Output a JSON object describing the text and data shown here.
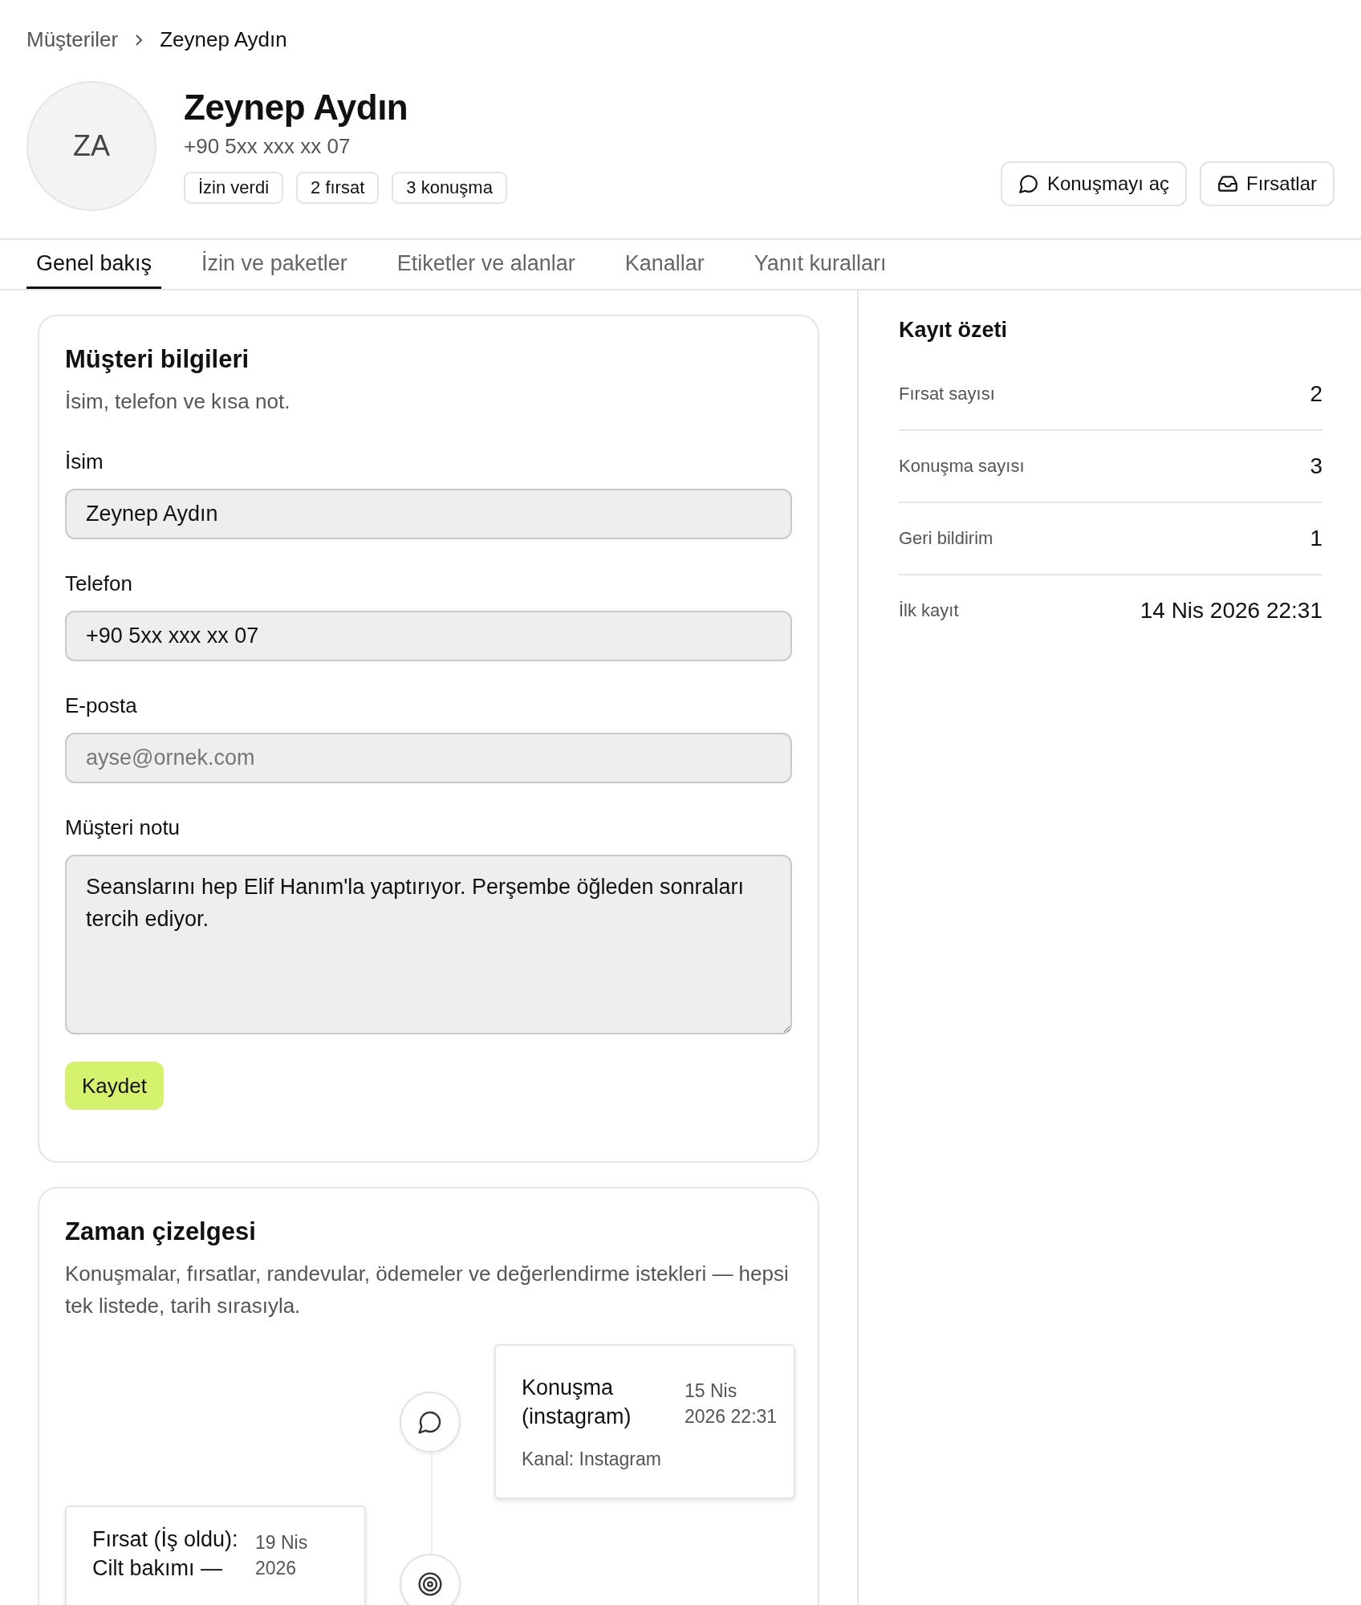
{
  "breadcrumb": {
    "parent": "Müşteriler",
    "current": "Zeynep Aydın"
  },
  "profile": {
    "initials": "ZA",
    "name": "Zeynep Aydın",
    "phone": "+90 5xx xxx xx 07",
    "chips": [
      "İzin verdi",
      "2 fırsat",
      "3 konuşma"
    ]
  },
  "actions": [
    {
      "kind": "chat",
      "label": "Konuşmayı aç"
    },
    {
      "kind": "inbox",
      "label": "Fırsatlar"
    }
  ],
  "tabs": [
    {
      "label": "Genel bakış",
      "selected": true
    },
    {
      "label": "İzin ve paketler",
      "selected": false
    },
    {
      "label": "Etiketler ve alanlar",
      "selected": false
    },
    {
      "label": "Kanallar",
      "selected": false
    },
    {
      "label": "Yanıt kuralları",
      "selected": false
    }
  ],
  "form": {
    "title": "Müşteri bilgileri",
    "subtitle": "İsim, telefon ve kısa not.",
    "fields": [
      {
        "kind": "input",
        "label": "İsim",
        "value": "Zeynep Aydın"
      },
      {
        "kind": "input",
        "label": "Telefon",
        "value": "+90 5xx xxx xx 07"
      },
      {
        "kind": "input",
        "label": "E-posta",
        "placeholder": "ayse@ornek.com"
      },
      {
        "kind": "textarea",
        "label": "Müşteri notu",
        "value": "Seanslarını hep Elif Hanım'la yaptırıyor. Perşembe öğleden sonraları tercih ediyor."
      }
    ],
    "save": "Kaydet"
  },
  "timeline": {
    "title": "Zaman çizelgesi",
    "subtitle": "Konuşmalar, fırsatlar, randevular, ödemeler ve değerlendirme istekleri — hepsi tek listede, tarih sırasıyla.",
    "events": [
      {
        "kind": "chat",
        "on_right": true,
        "title": "Konuşma (instagram)",
        "date": "15 Nis 2026 22:31",
        "detail": "Kanal: Instagram"
      },
      {
        "kind": "target",
        "on_right": false,
        "title": "Fırsat (İş oldu): Cilt bakımı —",
        "date": "19 Nis 2026"
      }
    ]
  },
  "summary": {
    "title": "Kayıt özeti",
    "rows": [
      {
        "label": "Fırsat sayısı",
        "value": "2"
      },
      {
        "label": "Konuşma sayısı",
        "value": "3"
      },
      {
        "label": "Geri bildirim",
        "value": "1"
      },
      {
        "label": "İlk kayıt",
        "value": "14 Nis 2026 22:31"
      }
    ]
  }
}
